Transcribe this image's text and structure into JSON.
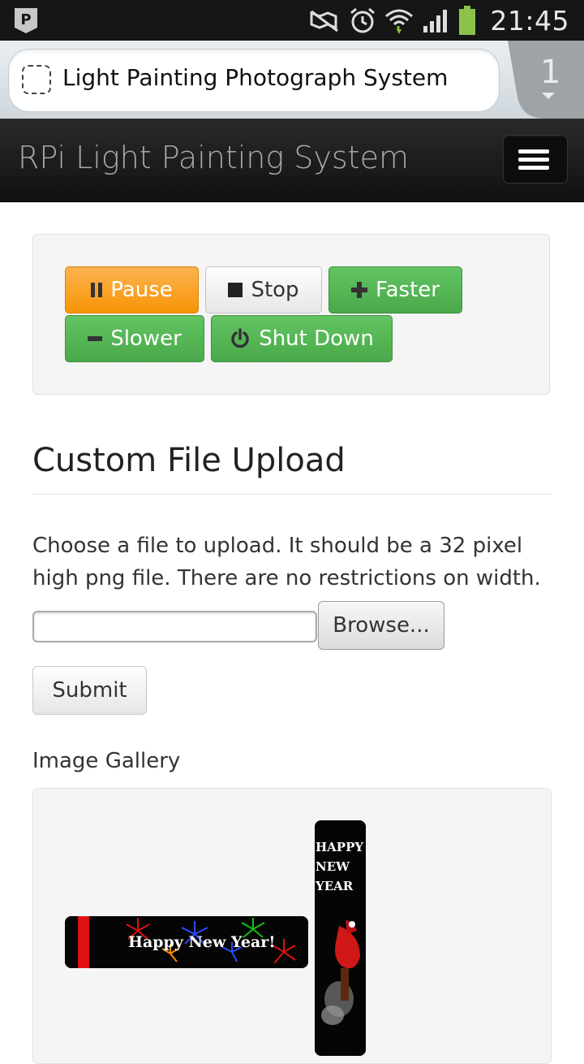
{
  "statusbar": {
    "time": "21:45",
    "icons": [
      "p-notification-icon",
      "mute-icon",
      "alarm-icon",
      "wifi-icon",
      "signal-icon",
      "battery-icon"
    ]
  },
  "browser": {
    "page_title": "Light Painting Photograph System",
    "tab_count": "1"
  },
  "navbar": {
    "brand": "RPi Light Painting System"
  },
  "controls": {
    "pause": "Pause",
    "stop": "Stop",
    "faster": "Faster",
    "slower": "Slower",
    "shutdown": "Shut Down"
  },
  "upload": {
    "heading": "Custom File Upload",
    "instructions": "Choose a file to upload. It should be a 32 pixel high png file. There are no restrictions on width.",
    "browse_label": "Browse...",
    "submit_label": "Submit"
  },
  "gallery": {
    "label": "Image Gallery",
    "images": [
      {
        "text": "Happy New Year!"
      },
      {
        "text": "HAPPY NEW YEAR"
      }
    ]
  },
  "colors": {
    "warning": "#f89406",
    "success": "#51a351",
    "navbar": "#1b1b1b"
  }
}
